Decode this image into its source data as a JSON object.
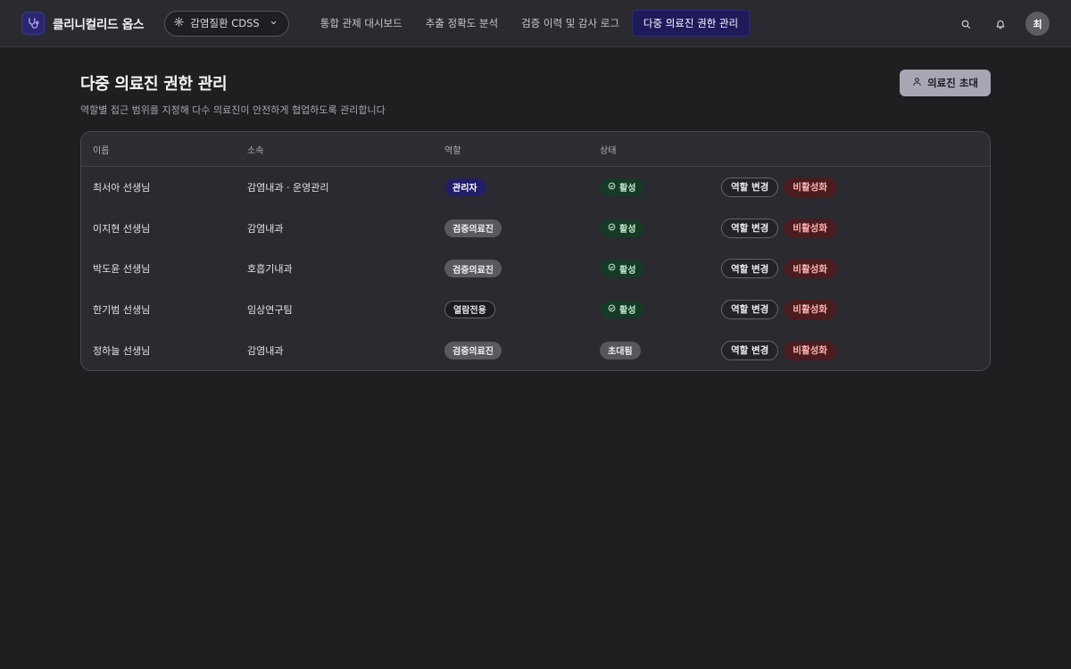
{
  "app": {
    "name": "클리니컬리드 옵스",
    "workspace": "감염질환 CDSS",
    "user_initial": "최"
  },
  "nav": {
    "items": [
      {
        "label": "통합 관제 대시보드"
      },
      {
        "label": "추출 정확도 분석"
      },
      {
        "label": "검증 이력 및 감사 로그"
      },
      {
        "label": "다중 의료진 권한 관리"
      }
    ],
    "active_index": 3
  },
  "page": {
    "title": "다중 의료진 권한 관리",
    "subtitle": "역할별 접근 범위를 지정해 다수 의료진이 안전하게 협업하도록 관리합니다",
    "invite_label": "의료진 초대"
  },
  "table": {
    "headers": {
      "name": "이름",
      "dept": "소속",
      "role": "역할",
      "status": "상태"
    },
    "rows": [
      {
        "name": "최서아 선생님",
        "dept": "감염내과 · 운영관리",
        "role": "관리자",
        "status": "활성"
      },
      {
        "name": "이지현 선생님",
        "dept": "감염내과",
        "role": "검증의료진",
        "status": "활성"
      },
      {
        "name": "박도윤 선생님",
        "dept": "호흡기내과",
        "role": "검증의료진",
        "status": "활성"
      },
      {
        "name": "한기범 선생님",
        "dept": "임상연구팀",
        "role": "열람전용",
        "status": "활성"
      },
      {
        "name": "정하늘 선생님",
        "dept": "감염내과",
        "role": "검증의료진",
        "status": "초대됨"
      }
    ],
    "actions": {
      "change_role": "역할 변경",
      "deactivate": "비활성화"
    }
  },
  "colors": {
    "accent": "#1f1a5a",
    "active_badge": "#173a26",
    "danger": "#4a1c1f",
    "background": "#1f1f22"
  },
  "icons": {
    "brand": "stethoscope-icon",
    "workspace": "gear-icon",
    "dropdown": "chevron-down-icon",
    "search": "search-icon",
    "notifications": "bell-icon",
    "invite": "user-icon",
    "active_status": "check-circle-icon"
  }
}
